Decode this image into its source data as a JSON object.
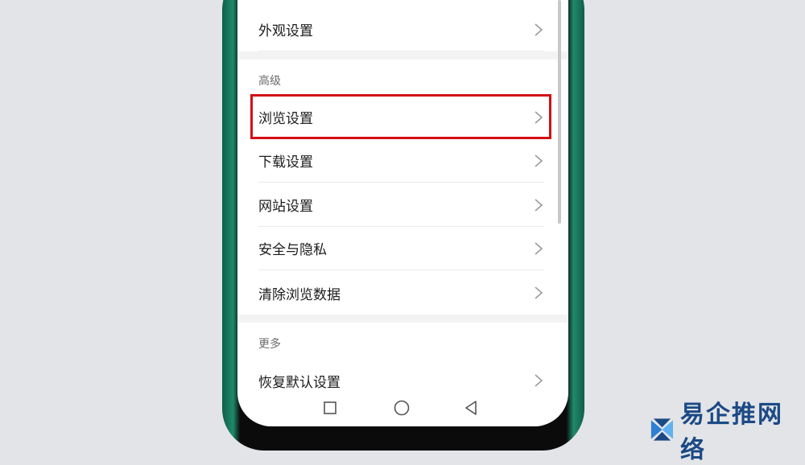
{
  "rows": {
    "appearance": "外观设置",
    "browse": "浏览设置",
    "download": "下载设置",
    "website": "网站设置",
    "security": "安全与隐私",
    "clear_data": "清除浏览数据",
    "restore": "恢复默认设置"
  },
  "sections": {
    "advanced": "高级",
    "more": "更多"
  },
  "colors": {
    "highlight": "#d40e14",
    "phone_edge": "#1f8a6a"
  },
  "icons": {
    "chevron": "chevron-right-icon",
    "nav_recent": "square-icon",
    "nav_home": "circle-icon",
    "nav_back": "triangle-back-icon",
    "watermark_logo": "brand-logo-icon"
  },
  "watermark": "易企推网络"
}
